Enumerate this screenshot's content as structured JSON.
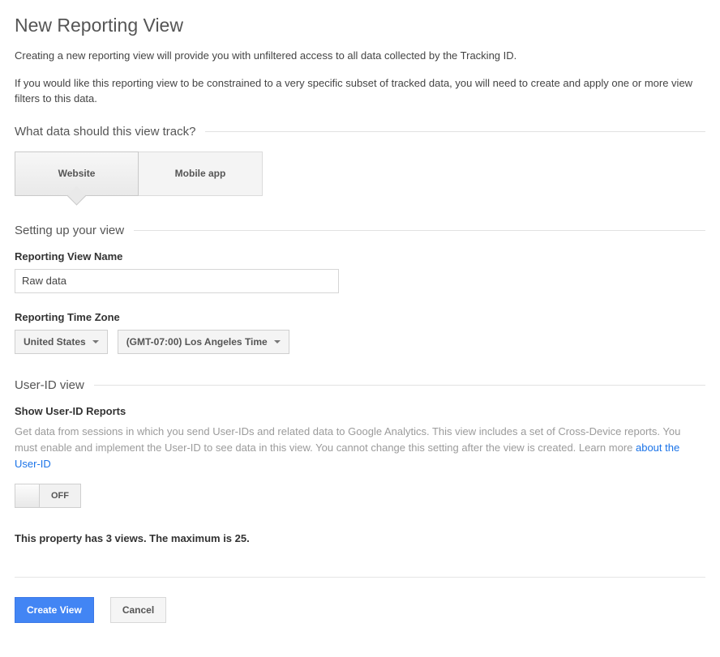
{
  "page": {
    "title": "New Reporting View",
    "intro1": "Creating a new reporting view will provide you with unfiltered access to all data collected by the Tracking ID.",
    "intro2": "If you would like this reporting view to be constrained to a very specific subset of tracked data, you will need to create and apply one or more view filters to this data."
  },
  "sections": {
    "track_heading": "What data should this view track?",
    "setup_heading": "Setting up your view",
    "uid_heading": "User-ID view"
  },
  "track_tabs": {
    "website": "Website",
    "mobile": "Mobile app"
  },
  "setup": {
    "name_label": "Reporting View Name",
    "name_value": "Raw data",
    "tz_label": "Reporting Time Zone",
    "country": "United States",
    "tz": "(GMT-07:00) Los Angeles Time"
  },
  "uid": {
    "subheading": "Show User-ID Reports",
    "desc_part1": "Get data from sessions in which you send User-IDs and related data to Google Analytics. This view includes a set of Cross-Device reports. You must enable and implement the User-ID to see data in this view. You cannot change this setting after the view is created. Learn more ",
    "link_text": "about the User-ID",
    "toggle_state": "OFF"
  },
  "views_note": "This property has 3 views. The maximum is 25.",
  "actions": {
    "create": "Create View",
    "cancel": "Cancel"
  }
}
